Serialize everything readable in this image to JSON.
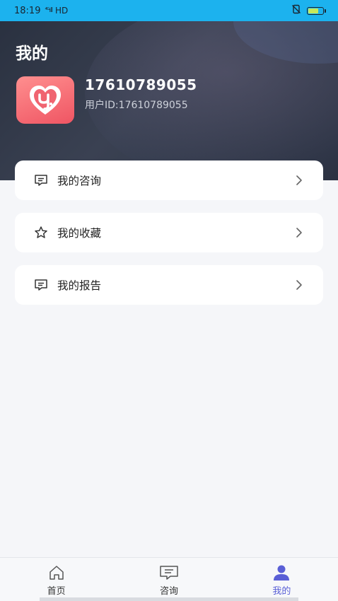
{
  "status_bar": {
    "time": "18:19",
    "signal": "⁴ᴳıll",
    "network": "HD",
    "icons": [
      "no-sim-icon",
      "battery-icon"
    ]
  },
  "header": {
    "title": "我的",
    "phone": "17610789055",
    "user_id": "用户ID:17610789055"
  },
  "menu": [
    {
      "label": "我的咨询",
      "icon": "message-icon"
    },
    {
      "label": "我的收藏",
      "icon": "star-icon"
    },
    {
      "label": "我的报告",
      "icon": "message-icon"
    }
  ],
  "tabs": [
    {
      "label": "首页",
      "icon": "home-icon",
      "active": false
    },
    {
      "label": "咨询",
      "icon": "message-icon",
      "active": false
    },
    {
      "label": "我的",
      "icon": "user-icon",
      "active": true
    }
  ],
  "colors": {
    "status_bar": "#1cb2ee",
    "accent": "#5a5fd6",
    "avatar": "#ef5563"
  }
}
